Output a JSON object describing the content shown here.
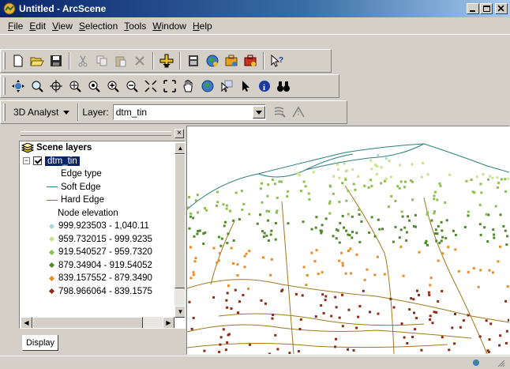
{
  "window": {
    "title": "Untitled - ArcScene"
  },
  "menu": [
    {
      "letter": "F",
      "rest": "ile"
    },
    {
      "letter": "E",
      "rest": "dit"
    },
    {
      "letter": "V",
      "rest": "iew"
    },
    {
      "letter": "S",
      "rest": "election"
    },
    {
      "letter": "T",
      "rest": "ools"
    },
    {
      "letter": "W",
      "rest": "indow"
    },
    {
      "letter": "H",
      "rest": "elp"
    }
  ],
  "analyst_toolbar": {
    "dropdown_label": "3D Analyst",
    "layer_label": "Layer:",
    "layer_value": "dtm_tin"
  },
  "toc": {
    "scene_layers_label": "Scene layers",
    "layer_name": "dtm_tin",
    "edge_type_heading": "Edge type",
    "edges": [
      {
        "label": "Soft Edge",
        "color": "#2c7f7f"
      },
      {
        "label": "Hard Edge",
        "color": "#a0781e"
      }
    ],
    "node_heading": "Node elevation",
    "nodes": [
      {
        "label": "999.923503 - 1,040.11",
        "color": "#a8d8d8"
      },
      {
        "label": "959.732015 - 999.9235",
        "color": "#c8e08c"
      },
      {
        "label": "919.540527 - 959.7320",
        "color": "#8cbe50"
      },
      {
        "label": "879.34904 - 919.54052",
        "color": "#4e8a2a"
      },
      {
        "label": "839.157552 - 879.3490",
        "color": "#e88c28"
      },
      {
        "label": "798.966064 - 839.1575",
        "color": "#8c2a14"
      }
    ],
    "display_tab": "Display"
  }
}
